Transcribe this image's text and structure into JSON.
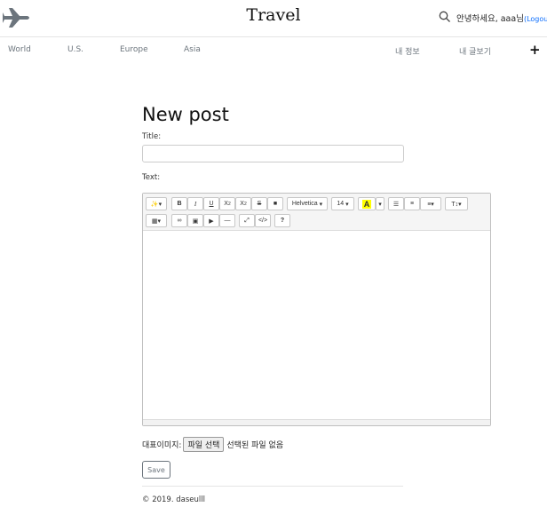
{
  "header": {
    "site_title": "Travel",
    "greeting": "안녕하세요, aaa님",
    "logout": "(Logout)"
  },
  "nav": {
    "items": [
      "World",
      "U.S.",
      "Europe",
      "Asia"
    ],
    "my_info": "내 정보",
    "my_posts": "내 글보기",
    "add": "+"
  },
  "form": {
    "heading": "New post",
    "title_label": "Title:",
    "title_value": "",
    "text_label": "Text:",
    "file_label": "대표이미지:",
    "file_button": "파일 선택",
    "file_status": "선택된 파일 없음",
    "save": "Save"
  },
  "toolbar": {
    "font_name": "Helvetica",
    "font_size": "14",
    "color_swatch": "#ffff00"
  },
  "footer": {
    "copyright": "© 2019. daseulll"
  },
  "colors": {
    "link": "#0d6efd",
    "muted": "#6c757d",
    "logo": "#6c757d"
  }
}
